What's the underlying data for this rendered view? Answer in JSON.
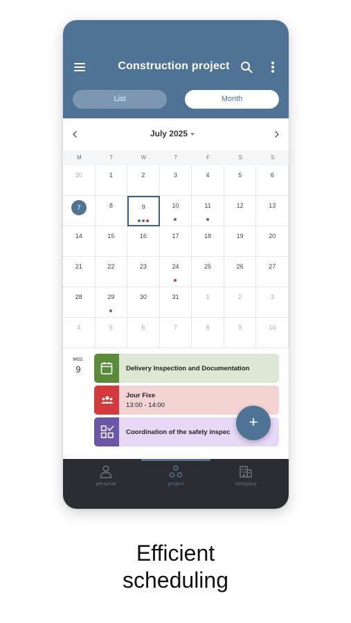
{
  "header": {
    "title": "Construction project",
    "view_tabs": [
      {
        "label": "List",
        "active": false
      },
      {
        "label": "Month",
        "active": true
      }
    ],
    "menu_icon": "hamburger-icon",
    "search_icon": "search-icon",
    "more_icon": "more-vertical-icon"
  },
  "calendar": {
    "month_label": "July 2025",
    "weekdays": [
      "M",
      "T",
      "W",
      "T",
      "F",
      "S",
      "S"
    ],
    "today": "7",
    "selected": "9",
    "weeks": [
      [
        {
          "d": "30",
          "muted": true
        },
        {
          "d": "1"
        },
        {
          "d": "2"
        },
        {
          "d": "3"
        },
        {
          "d": "4"
        },
        {
          "d": "5"
        },
        {
          "d": "6"
        }
      ],
      [
        {
          "d": "7",
          "today": true
        },
        {
          "d": "8"
        },
        {
          "d": "9",
          "selected": true,
          "dots": [
            "#3f8a2e",
            "#4f7394",
            "#d9363e"
          ]
        },
        {
          "d": "10",
          "dots": [
            "#4f7394"
          ]
        },
        {
          "d": "11",
          "dots": [
            "#3f8a2e"
          ]
        },
        {
          "d": "12"
        },
        {
          "d": "13"
        }
      ],
      [
        {
          "d": "14"
        },
        {
          "d": "15"
        },
        {
          "d": "16"
        },
        {
          "d": "17"
        },
        {
          "d": "18"
        },
        {
          "d": "19"
        },
        {
          "d": "20"
        }
      ],
      [
        {
          "d": "21"
        },
        {
          "d": "22"
        },
        {
          "d": "23"
        },
        {
          "d": "24",
          "dots": [
            "#d9363e"
          ]
        },
        {
          "d": "25"
        },
        {
          "d": "26"
        },
        {
          "d": "27"
        }
      ],
      [
        {
          "d": "28"
        },
        {
          "d": "29",
          "dots": [
            "#6a57a8"
          ]
        },
        {
          "d": "30"
        },
        {
          "d": "31"
        },
        {
          "d": "1",
          "muted": true
        },
        {
          "d": "2",
          "muted": true
        },
        {
          "d": "3",
          "muted": true
        }
      ],
      [
        {
          "d": "4",
          "muted": true
        },
        {
          "d": "5",
          "muted": true
        },
        {
          "d": "6",
          "muted": true
        },
        {
          "d": "7",
          "muted": true
        },
        {
          "d": "8",
          "muted": true
        },
        {
          "d": "9",
          "muted": true
        },
        {
          "d": "10",
          "muted": true
        }
      ]
    ]
  },
  "agenda": {
    "day_name": "WED.",
    "day_number": "9",
    "events": [
      {
        "title": "Delivery Inspection and Documentation",
        "subtitle": "",
        "icon": "calendar-icon",
        "accent": "#5b8a3a",
        "bg": "#dce8d3"
      },
      {
        "title": "Jour Fixe",
        "subtitle": "13:00 - 14:00",
        "icon": "group-icon",
        "accent": "#d33a3e",
        "bg": "#f4d3d3"
      },
      {
        "title": "Coordination of the safety inspec",
        "subtitle": "",
        "icon": "checklist-icon",
        "accent": "#6a57a8",
        "bg": "#e6d9f6"
      }
    ]
  },
  "fab": {
    "label": "+",
    "icon": "plus-icon"
  },
  "bottom_nav": [
    {
      "label": "personal",
      "icon": "person-icon",
      "active": false
    },
    {
      "label": "project",
      "icon": "project-icon",
      "active": true
    },
    {
      "label": "company",
      "icon": "building-icon",
      "active": false
    }
  ],
  "caption": {
    "line1": "Efficient",
    "line2": "scheduling"
  },
  "colors": {
    "primary": "#4f7394",
    "nav_bg": "#2b2d30"
  }
}
